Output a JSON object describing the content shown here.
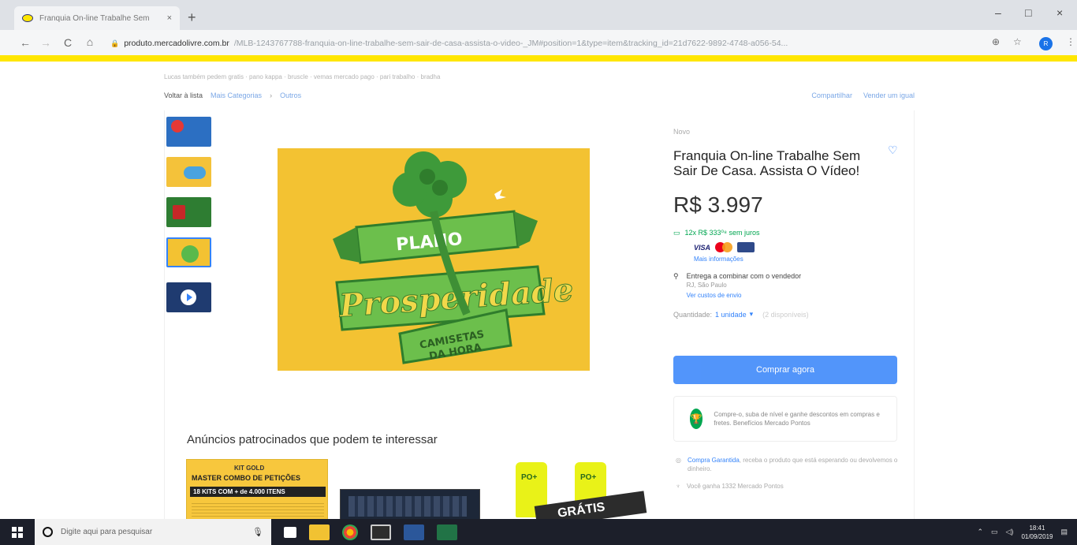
{
  "browser": {
    "tab_title": "Franquia On-line Trabalhe Sem",
    "tab_close": "×",
    "new_tab": "+",
    "window_min": "–",
    "window_max": "□",
    "window_close": "×",
    "nav": {
      "back": "←",
      "forward": "→",
      "reload": "C",
      "home": "⌂"
    },
    "url_host": "produto.mercadolivre.com.br",
    "url_path": "/MLB-1243767788-franquia-on-line-trabalhe-sem-sair-de-casa-assista-o-video-_JM#position=1&type=item&tracking_id=21d7622-9892-4748-a056-54...",
    "zoom_icon": "⊕",
    "star_icon": "☆",
    "profile_initial": "R",
    "menu_icon": "⋮"
  },
  "page": {
    "breadcrumb_top": "Lucas também pedem gratis · pano kappa · bruscle · vemas mercado pago · pari trabalho · bradha",
    "back_to_list": "Voltar à lista",
    "category_links": [
      "Mais Categorias",
      "Outros"
    ],
    "crumb_sep": "›",
    "share": "Compartilhar",
    "sell_one": "Vender um igual"
  },
  "product": {
    "condition": "Novo",
    "title": "Franquia On-line Trabalhe Sem Sair De Casa. Assista O Vídeo!",
    "price": "R$ 3.997",
    "installments": "12x R$ 333⁰⁸ sem juros",
    "card_brand_visa": "VISA",
    "more_info": "Mais informações",
    "delivery": "Entrega a combinar com o vendedor",
    "delivery_location": "RJ, São Paulo",
    "shipping_link": "Ver custos de envio",
    "quantity_label": "Quantidade:",
    "quantity_value": "1 unidade",
    "quantity_available": "(2 disponíveis)",
    "buy_button": "Comprar agora",
    "loyalty_text": "Compre-o, suba de nível e ganhe descontos em compras e fretes. Benefícios Mercado Pontos",
    "guarantee_link": "Compra Garantida",
    "guarantee_text": ", receba o produto que está esperando ou devolvemos o dinheiro.",
    "points_text": "Você ganha 1332 Mercado Pontos"
  },
  "image_text": {
    "plan": "PLANO",
    "prosperity": "Prosperidade",
    "tshirts_1": "CAMISETAS",
    "tshirts_2": "DA HORA"
  },
  "ads": {
    "title": "Anúncios patrocinados que podem te interessar",
    "ad1_l1": "KIT GOLD",
    "ad1_l2": "MASTER COMBO DE PETIÇÕES",
    "ad1_l3": "18 KITS COM + de 4.000 ITENS",
    "ad3_tube": "PO+",
    "ad3_banner": "GRÁTIS"
  },
  "taskbar": {
    "search_placeholder": "Digite aqui para pesquisar",
    "time": "18:41",
    "date": "01/09/2019"
  },
  "colors": {
    "ml_yellow": "#ffe600",
    "link_blue": "#3483fa",
    "green": "#00a650",
    "image_bg": "#f3c232"
  }
}
